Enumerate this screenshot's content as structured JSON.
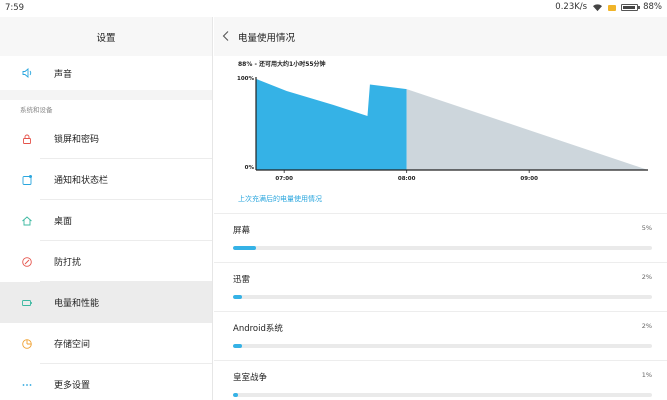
{
  "status_bar": {
    "time": "7:59",
    "network_speed": "0.23K/s",
    "battery_text": "88%",
    "battery_level": 0.88
  },
  "left_panel": {
    "title": "设置",
    "top_item": {
      "label": "声音",
      "icon": "speaker-icon"
    },
    "section_label": "系统和设备",
    "items": [
      {
        "label": "锁屏和密码",
        "icon": "lock-icon",
        "color": "#e5534b"
      },
      {
        "label": "通知和状态栏",
        "icon": "notification-icon",
        "color": "#2aa6de"
      },
      {
        "label": "桌面",
        "icon": "home-icon",
        "color": "#3bb8a0"
      },
      {
        "label": "防打扰",
        "icon": "do-not-disturb-icon",
        "color": "#e5534b"
      },
      {
        "label": "电量和性能",
        "icon": "battery-icon",
        "color": "#3bb8a0",
        "active": true
      },
      {
        "label": "存储空间",
        "icon": "storage-icon",
        "color": "#f0a030"
      },
      {
        "label": "更多设置",
        "icon": "more-icon",
        "color": "#2aa6de"
      }
    ]
  },
  "right_panel": {
    "title": "电量使用情况",
    "summary": "88% - 还可用大约1小时55分钟",
    "history_link": "上次充满后的电量使用情况",
    "usage": [
      {
        "name": "屏幕",
        "percent_text": "5%",
        "fraction": 0.05
      },
      {
        "name": "迅雷",
        "percent_text": "2%",
        "fraction": 0.02
      },
      {
        "name": "Android系统",
        "percent_text": "2%",
        "fraction": 0.02
      },
      {
        "name": "皇室战争",
        "percent_text": "1%",
        "fraction": 0.01
      }
    ]
  },
  "chart_data": {
    "type": "area",
    "ylim": [
      0,
      100
    ],
    "y_tick_labels": [
      "100%",
      "0%"
    ],
    "x_tick_labels": [
      "07:00",
      "08:00",
      "09:00"
    ],
    "x_ticks_hours": [
      7.0,
      8.0,
      9.0
    ],
    "xlim_hours": [
      6.77,
      9.97
    ],
    "series": [
      {
        "kind": "actual",
        "color": "#35b2e6",
        "points": [
          [
            6.77,
            100
          ],
          [
            6.77,
            98
          ],
          [
            7.02,
            85
          ],
          [
            7.4,
            70
          ],
          [
            7.68,
            58
          ],
          [
            7.7,
            92
          ],
          [
            8.0,
            87
          ]
        ]
      },
      {
        "kind": "projected",
        "color": "#cdd6dc",
        "points": [
          [
            8.0,
            87
          ],
          [
            9.97,
            0
          ]
        ]
      }
    ]
  }
}
